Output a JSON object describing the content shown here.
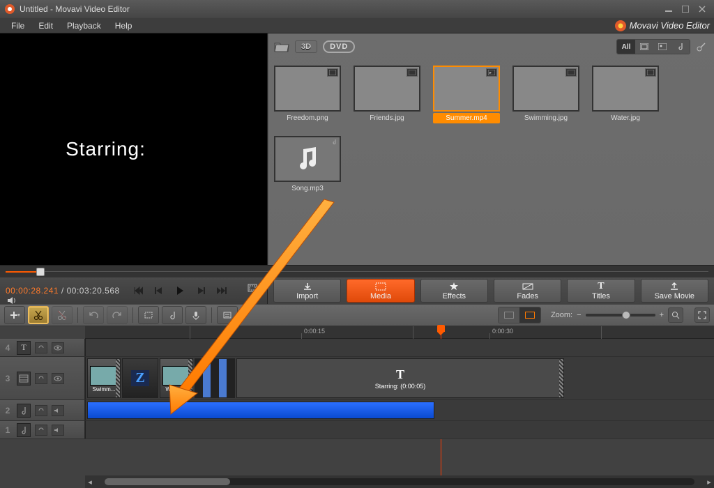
{
  "window": {
    "title": "Untitled - Movavi Video Editor",
    "brand": "Movavi Video Editor"
  },
  "menu": {
    "file": "File",
    "edit": "Edit",
    "playback": "Playback",
    "help": "Help"
  },
  "preview": {
    "text": "Starring:"
  },
  "timecode": {
    "current": "00:00:28.241",
    "total": "00:03:20.568",
    "sep": " / "
  },
  "media_toolbar": {
    "threeD": "3D",
    "dvd": "DVD",
    "all": "All"
  },
  "thumbs": [
    {
      "label": "Freedom.png",
      "cls": "ph-beach1",
      "selected": false
    },
    {
      "label": "Friends.jpg",
      "cls": "ph-beach2",
      "selected": false
    },
    {
      "label": "Summer.mp4",
      "cls": "ph-beach3",
      "selected": true,
      "video": true
    },
    {
      "label": "Swimming.jpg",
      "cls": "ph-swim",
      "selected": false
    },
    {
      "label": "Water.jpg",
      "cls": "ph-water",
      "selected": false
    },
    {
      "label": "Song.mp3",
      "music": true,
      "selected": false
    }
  ],
  "tabs": {
    "import": "Import",
    "media": "Media",
    "effects": "Effects",
    "fades": "Fades",
    "titles": "Titles",
    "save": "Save Movie"
  },
  "zoom": {
    "label": "Zoom:"
  },
  "ruler": {
    "t1": "0:00:15",
    "t2": "0:00:30"
  },
  "tracks": {
    "n4": "4",
    "n3": "3",
    "n2": "2",
    "n1": "1"
  },
  "clips": {
    "swim": "Swimm...",
    "water": "Water.j...",
    "title_big": "T",
    "title_small": "Starring: (0:00:05)"
  }
}
